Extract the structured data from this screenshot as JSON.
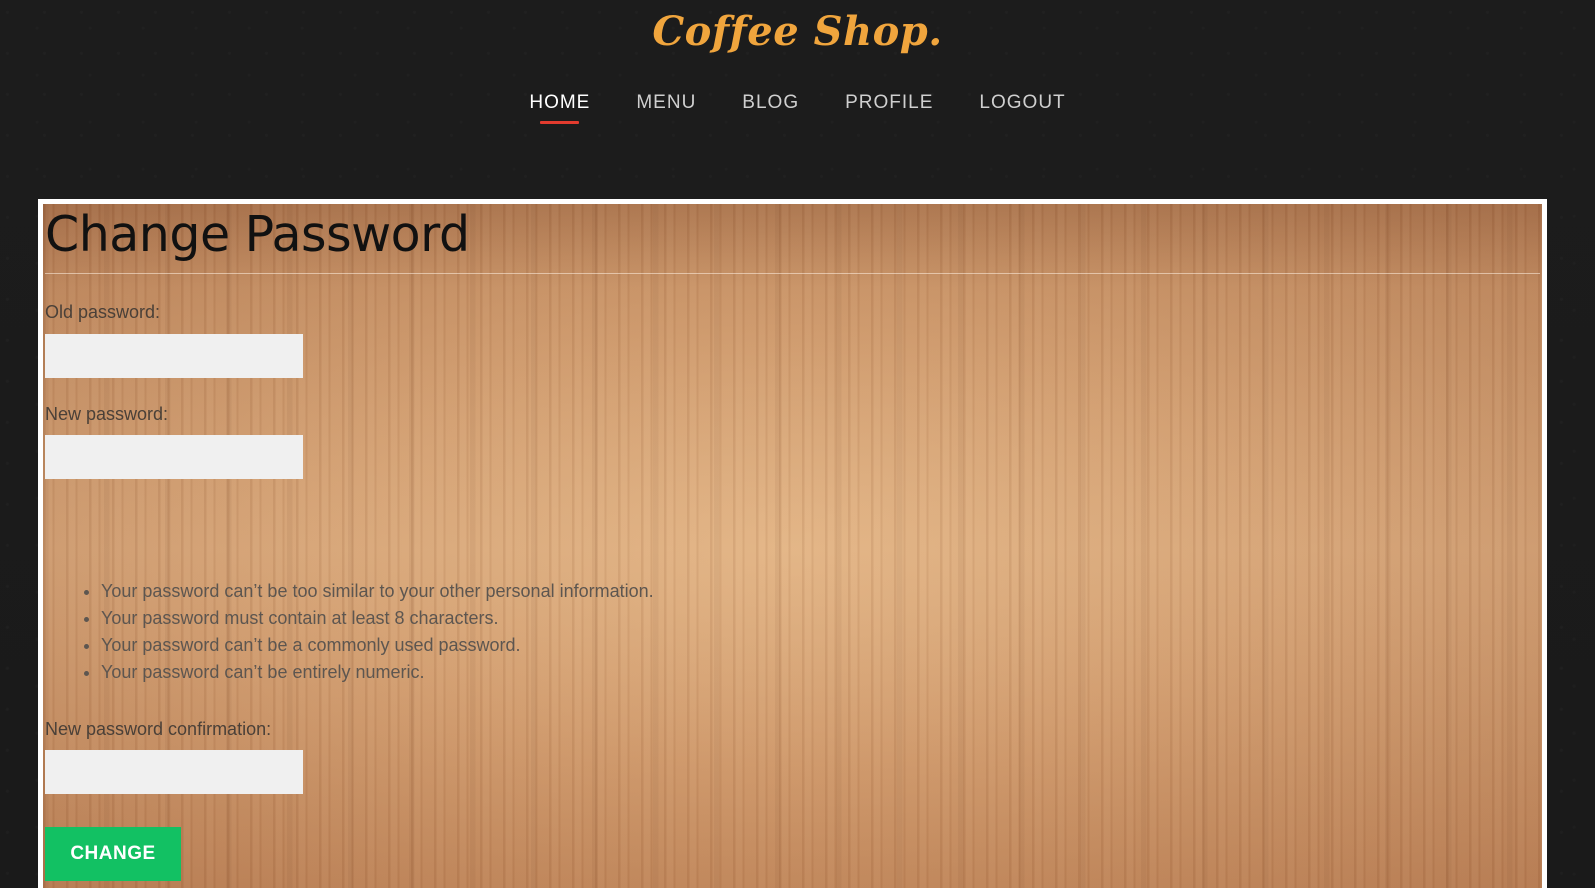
{
  "site": {
    "logo": "Coffee Shop."
  },
  "nav": {
    "items": [
      {
        "label": "HOME",
        "active": true
      },
      {
        "label": "MENU",
        "active": false
      },
      {
        "label": "BLOG",
        "active": false
      },
      {
        "label": "PROFILE",
        "active": false
      },
      {
        "label": "LOGOUT",
        "active": false
      }
    ]
  },
  "form": {
    "title": "Change Password",
    "old_password": {
      "label": "Old password:",
      "value": ""
    },
    "new_password": {
      "label": "New password:",
      "value": ""
    },
    "help_items": [
      "Your password can’t be too similar to your other personal information.",
      "Your password must contain at least 8 characters.",
      "Your password can’t be a commonly used password.",
      "Your password can’t be entirely numeric."
    ],
    "confirm_password": {
      "label": "New password confirmation:",
      "value": ""
    },
    "submit_label": "CHANGE"
  },
  "colors": {
    "logo": "#f0a53d",
    "nav_active_underline": "#e23b2e",
    "button": "#12c163",
    "page_background": "#1b1b1b"
  }
}
